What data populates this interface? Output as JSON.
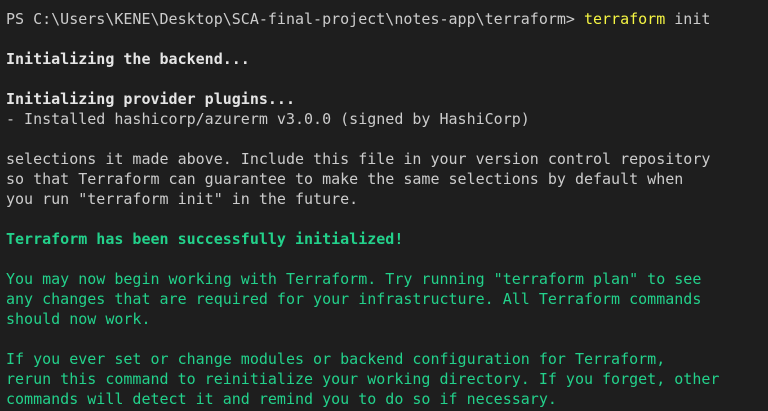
{
  "terminal": {
    "prompt": "PS C:\\Users\\KENE\\Desktop\\SCA-final-project\\notes-app\\terraform> ",
    "command_name": "terraform",
    "command_args": " init",
    "backend_msg": "Initializing the backend...",
    "provider_msg": "Initializing provider plugins...",
    "installed_msg": "- Installed hashicorp/azurerm v3.0.0 (signed by HashiCorp)",
    "selections": [
      "selections it made above. Include this file in your version control repository",
      "so that Terraform can guarantee to make the same selections by default when",
      "you run \"terraform init\" in the future."
    ],
    "success_msg": "Terraform has been successfully initialized!",
    "working": [
      "You may now begin working with Terraform. Try running \"terraform plan\" to see",
      "any changes that are required for your infrastructure. All Terraform commands",
      "should now work."
    ],
    "reinit": [
      "If you ever set or change modules or backend configuration for Terraform,",
      "rerun this command to reinitialize your working directory. If you forget, other",
      "commands will detect it and remind you to do so if necessary."
    ],
    "colors": {
      "background": "#1e1e1e",
      "text": "#cccccc",
      "success": "#23d18b",
      "command": "#f5f543"
    }
  }
}
